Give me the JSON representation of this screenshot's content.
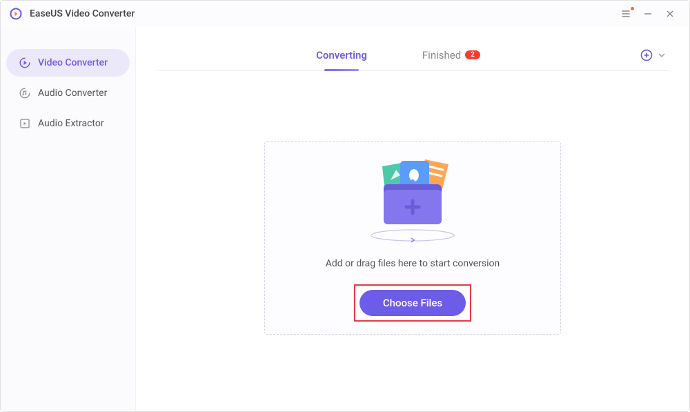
{
  "app": {
    "title": "EaseUS Video Converter"
  },
  "sidebar": {
    "items": [
      {
        "label": "Video Converter",
        "icon": "video-convert-icon",
        "active": true
      },
      {
        "label": "Audio Converter",
        "icon": "audio-convert-icon",
        "active": false
      },
      {
        "label": "Audio Extractor",
        "icon": "audio-extract-icon",
        "active": false
      }
    ]
  },
  "tabs": {
    "converting": {
      "label": "Converting",
      "active": true
    },
    "finished": {
      "label": "Finished",
      "badge": "2",
      "active": false
    }
  },
  "dropzone": {
    "hint": "Add or drag files here to start conversion",
    "button": "Choose Files"
  }
}
